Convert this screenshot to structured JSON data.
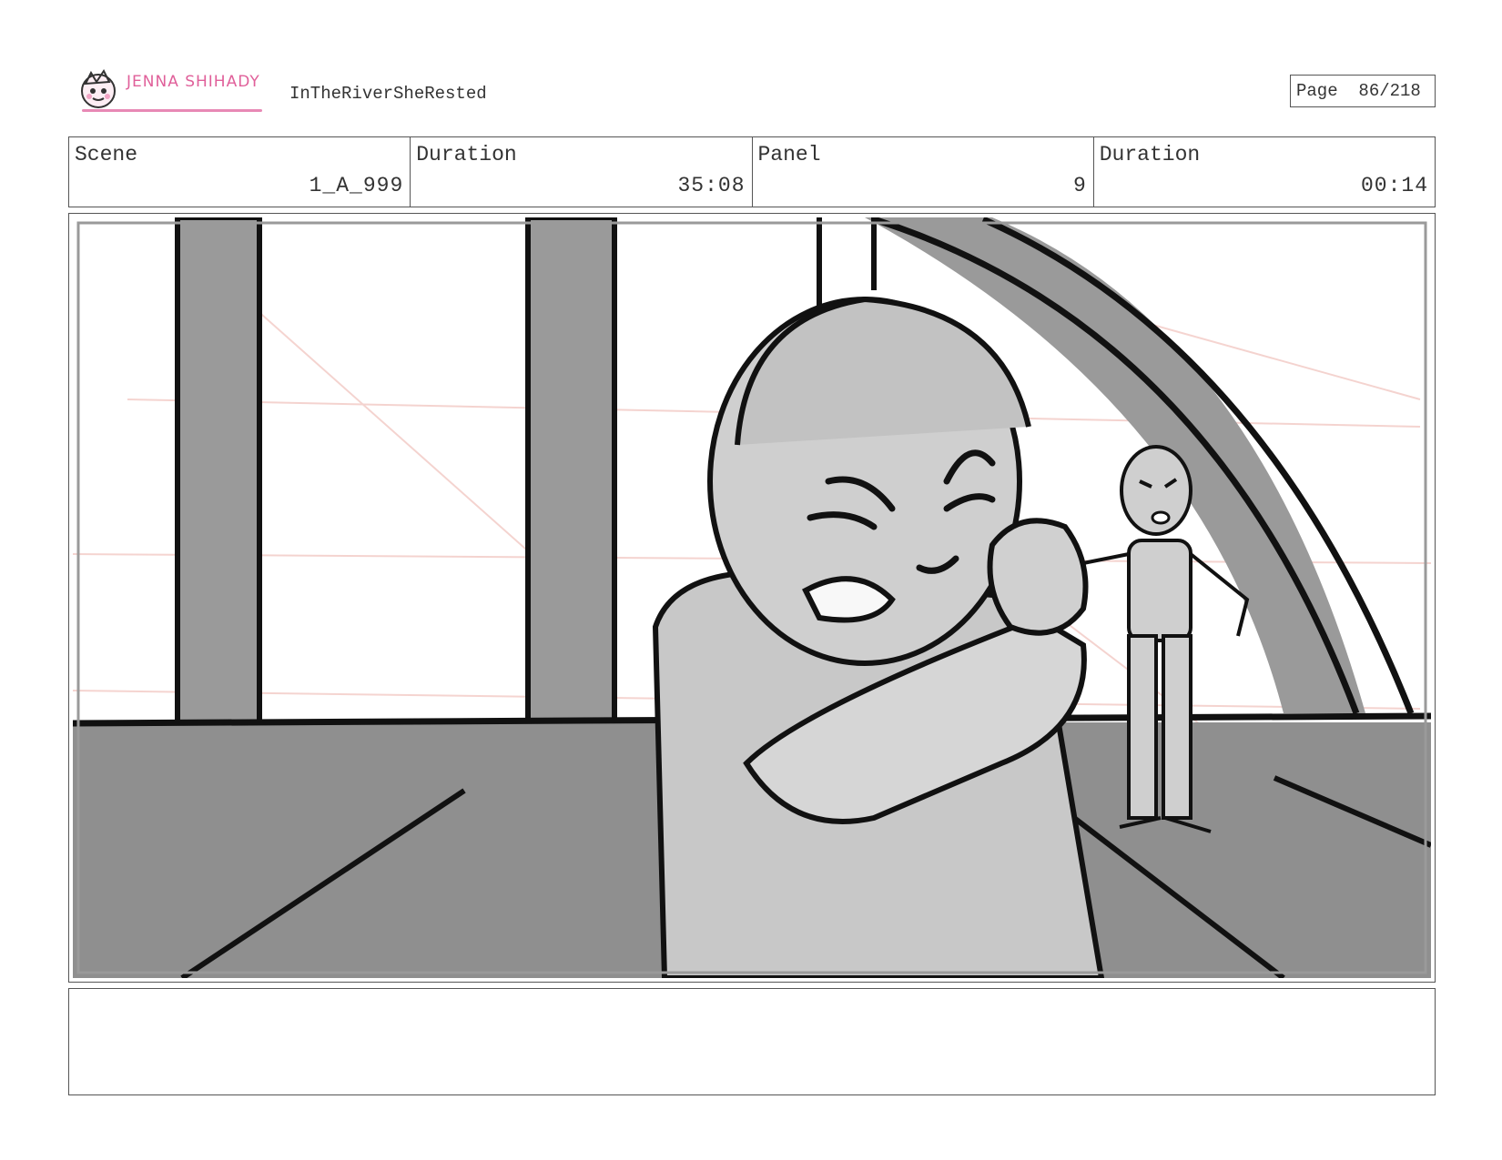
{
  "header": {
    "logo_text": "JENNA SHIHADY",
    "project_title": "InTheRiverSheRested",
    "page_label": "Page",
    "page_value": "86/218"
  },
  "info_row": [
    {
      "label": "Scene",
      "value": "1_A_999"
    },
    {
      "label": "Duration",
      "value": "35:08"
    },
    {
      "label": "Panel",
      "value": "9"
    },
    {
      "label": "Duration",
      "value": "00:14"
    }
  ],
  "panel": {
    "icon": "storyboard-sketch",
    "palette": {
      "dark_gray": "#8f8f8f",
      "mid_gray": "#b5b5b5",
      "light_gray": "#cfcfcf",
      "line": "#111111",
      "sketch_red": "#f2c9c4"
    }
  },
  "notes": {
    "text": ""
  }
}
